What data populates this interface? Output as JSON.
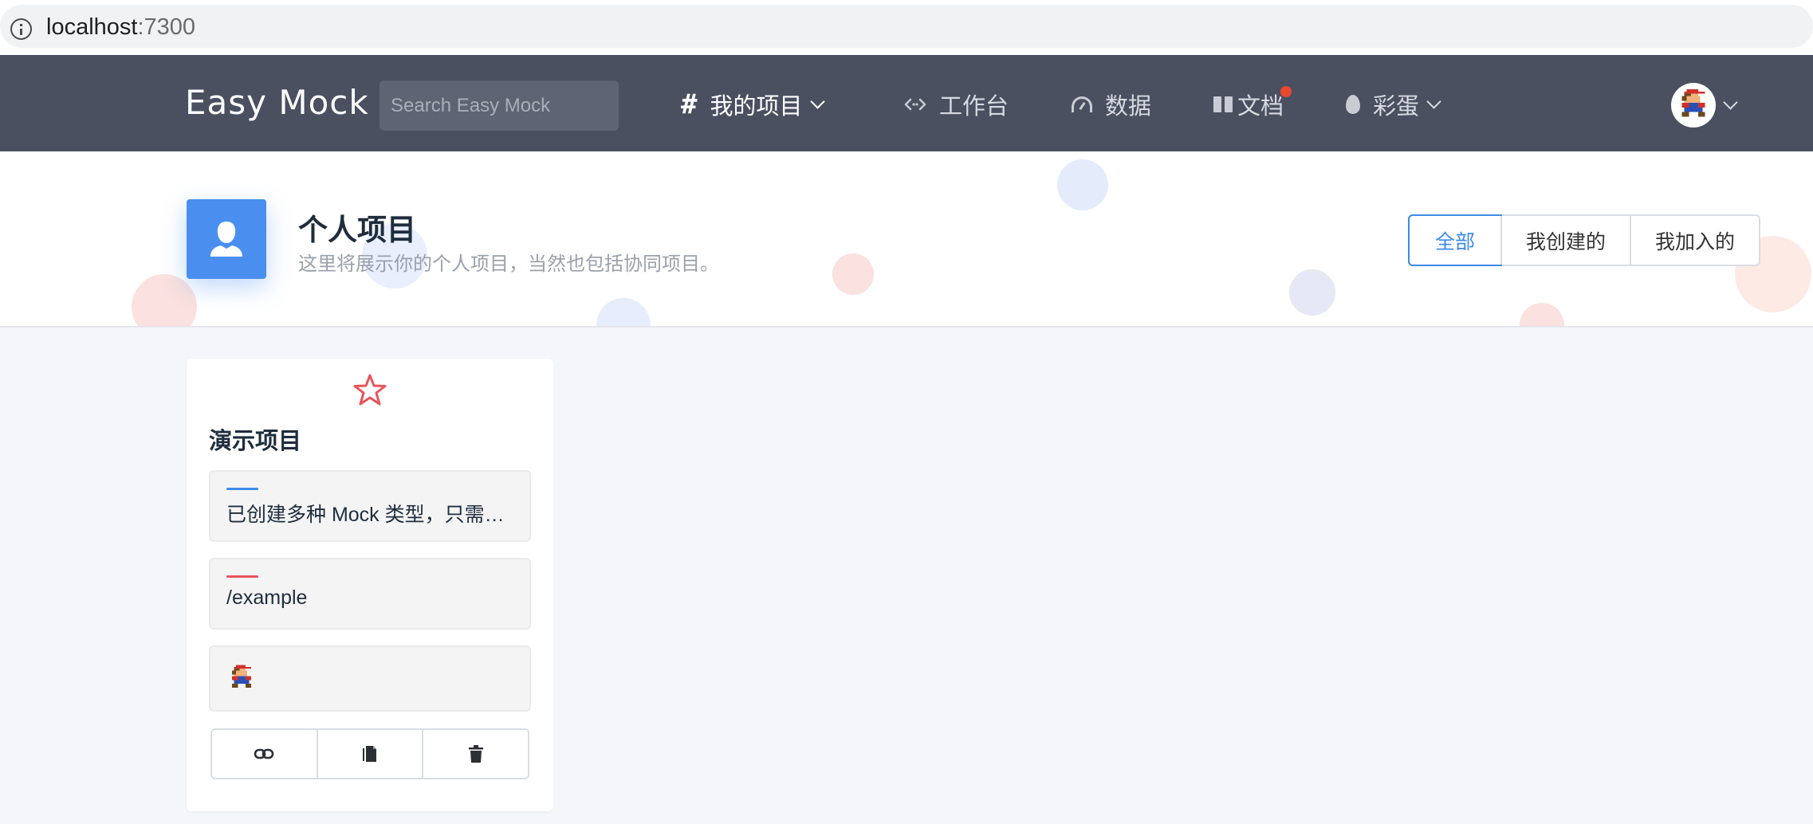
{
  "browser": {
    "host": "localhost",
    "port": ":7300"
  },
  "navbar": {
    "logo": "Easy Mock",
    "search_placeholder": "Search Easy Mock",
    "items": [
      {
        "label": "我的项目",
        "icon": "hash-icon",
        "dropdown": true,
        "active": true
      },
      {
        "label": "工作台",
        "icon": "code-icon",
        "dropdown": false
      },
      {
        "label": "数据",
        "icon": "dashboard-icon",
        "dropdown": false
      },
      {
        "label": "文档",
        "icon": "book-icon",
        "dropdown": false,
        "badge": true
      },
      {
        "label": "彩蛋",
        "icon": "egg-icon",
        "dropdown": true
      }
    ]
  },
  "hero": {
    "title": "个人项目",
    "subtitle": "这里将展示你的个人项目，当然也包括协同项目。",
    "filters": [
      "全部",
      "我创建的",
      "我加入的"
    ],
    "active_filter": "全部"
  },
  "project_card": {
    "title": "演示项目",
    "description": "已创建多种 Mock 类型，只需点击预览便可查看效果",
    "base_url": "/example",
    "actions": [
      "link-icon",
      "copy-icon",
      "trash-icon"
    ]
  },
  "colors": {
    "navbar": "#4a5060",
    "primary": "#3d8ae8",
    "accent_red": "#e8545a"
  }
}
